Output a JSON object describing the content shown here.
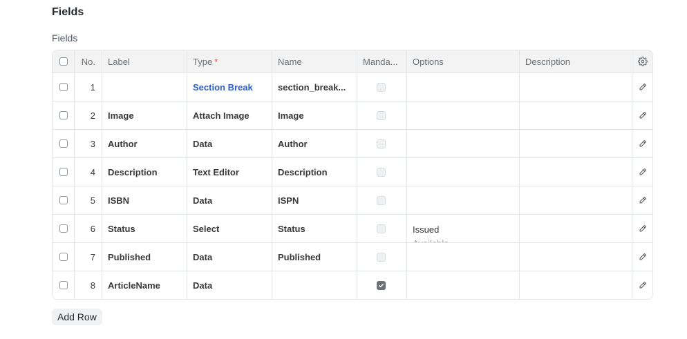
{
  "section": {
    "title": "Fields"
  },
  "field": {
    "label": "Fields"
  },
  "grid": {
    "headers": {
      "no": "No.",
      "label": "Label",
      "type": "Type",
      "type_required": "*",
      "name": "Name",
      "mandatory": "Manda...",
      "options": "Options",
      "description": "Description"
    },
    "rows": [
      {
        "no": "1",
        "label": "",
        "type": "Section Break",
        "name": "section_break...",
        "mandatory": false,
        "options": [],
        "description": ""
      },
      {
        "no": "2",
        "label": "Image",
        "type": "Attach Image",
        "name": "Image",
        "mandatory": false,
        "options": [],
        "description": ""
      },
      {
        "no": "3",
        "label": "Author",
        "type": "Data",
        "name": "Author",
        "mandatory": false,
        "options": [],
        "description": ""
      },
      {
        "no": "4",
        "label": "Description",
        "type": "Text Editor",
        "name": "Description",
        "mandatory": false,
        "options": [],
        "description": ""
      },
      {
        "no": "5",
        "label": "ISBN",
        "type": "Data",
        "name": "ISPN",
        "mandatory": false,
        "options": [],
        "description": ""
      },
      {
        "no": "6",
        "label": "Status",
        "type": "Select",
        "name": "Status",
        "mandatory": false,
        "options": [
          "Issued",
          "Available"
        ],
        "description": ""
      },
      {
        "no": "7",
        "label": "Published",
        "type": "Data",
        "name": "Published",
        "mandatory": false,
        "options": [],
        "description": ""
      },
      {
        "no": "8",
        "label": "ArticleName",
        "type": "Data",
        "name": "",
        "mandatory": true,
        "options": [],
        "description": ""
      }
    ]
  },
  "actions": {
    "add_row": "Add Row"
  },
  "icons": {
    "settings": "gear-icon",
    "edit": "pencil-icon"
  },
  "colors": {
    "link": "#2f5fc4",
    "required": "#e24c4c"
  }
}
